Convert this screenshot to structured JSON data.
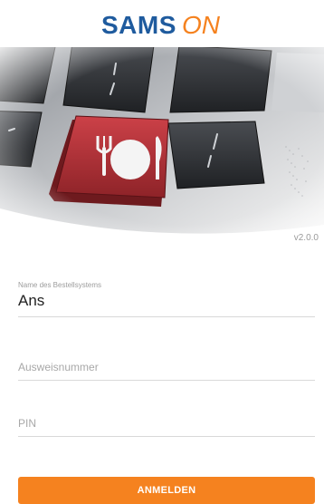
{
  "app": {
    "logo_text_primary": "SAMS",
    "logo_text_secondary": "ON",
    "version": "v2.0.0"
  },
  "hero": {
    "icon": "fork-plate-knife-icon"
  },
  "form": {
    "system_name": {
      "label": "Name des Bestellsystems",
      "value": "Ans"
    },
    "id_number": {
      "placeholder": "Ausweisnummer",
      "value": ""
    },
    "pin": {
      "placeholder": "PIN",
      "value": ""
    }
  },
  "login_button": {
    "label": "ANMELDEN"
  },
  "colors": {
    "brand_blue": "#1f5b9e",
    "brand_orange": "#f5821f",
    "key_red": "#b8333a"
  }
}
